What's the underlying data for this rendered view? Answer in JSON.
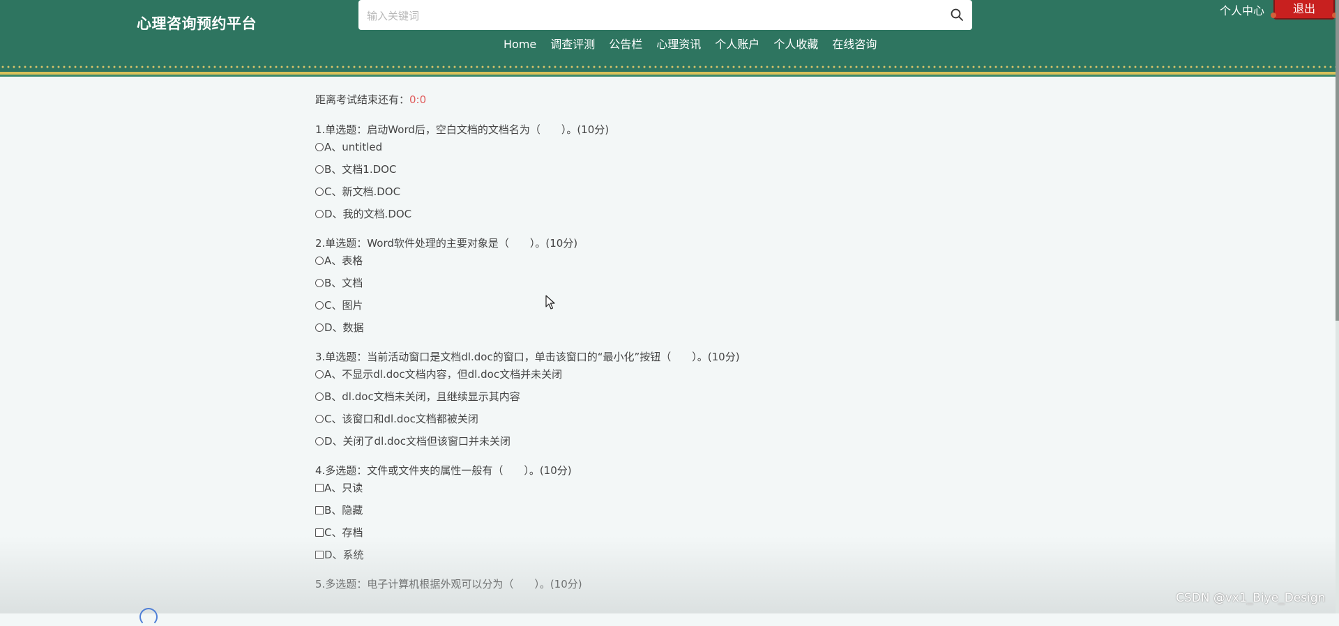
{
  "header": {
    "site_title": "心理咨询预约平台",
    "search_placeholder": "输入关键词",
    "user_center": "个人中心",
    "logout": "退出",
    "nav": [
      "Home",
      "调查评测",
      "公告栏",
      "心理资讯",
      "个人账户",
      "个人收藏",
      "在线咨询"
    ]
  },
  "exam": {
    "timer_label": "距离考试结束还有：",
    "timer_value": "0:0",
    "questions": [
      {
        "title": "1.单选题：启动Word后，空白文档的文档名为（　　）。(10分)",
        "type": "radio",
        "options": [
          "A、untitled",
          "B、文档1.DOC",
          "C、新文档.DOC",
          "D、我的文档.DOC"
        ]
      },
      {
        "title": "2.单选题：Word软件处理的主要对象是（　　）。(10分)",
        "type": "radio",
        "options": [
          "A、表格",
          "B、文档",
          "C、图片",
          "D、数据"
        ]
      },
      {
        "title": "3.单选题：当前活动窗口是文档dl.doc的窗口，单击该窗口的“最小化”按钮（　　）。(10分)",
        "type": "radio",
        "options": [
          "A、不显示dl.doc文档内容，但dl.doc文档并未关闭",
          "B、dl.doc文档未关闭，且继续显示其内容",
          "C、该窗口和dl.doc文档都被关闭",
          "D、关闭了dl.doc文档但该窗口并未关闭"
        ]
      },
      {
        "title": "4.多选题：文件或文件夹的属性一般有（　　）。(10分)",
        "type": "checkbox",
        "options": [
          "A、只读",
          "B、隐藏",
          "C、存档",
          "D、系统"
        ]
      },
      {
        "title": "5.多选题：电子计算机根据外观可以分为（　　）。(10分)",
        "type": "checkbox",
        "options": []
      }
    ]
  },
  "watermark": "CSDN @vx1_Biye_Design",
  "colors": {
    "header_bg": "#2e7560",
    "accent_gold": "#d8c15a",
    "logout_red": "#c8201f",
    "timer_red": "#e05c5c"
  }
}
